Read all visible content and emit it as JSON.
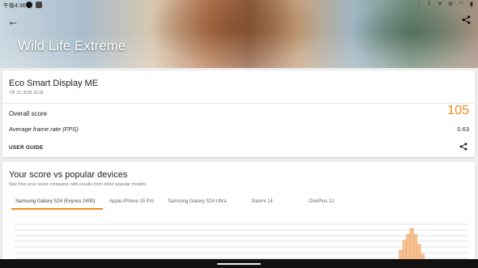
{
  "status_bar": {
    "time": "午後4:36",
    "icons": [
      "notification-dot-icon",
      "app-icon",
      "vibrate-icon",
      "bluetooth-icon",
      "mute-icon",
      "dnd-icon",
      "wifi-icon",
      "battery-icon"
    ]
  },
  "header": {
    "title": "Wild Life Extreme",
    "back_icon": "arrow-left-icon",
    "share_icon": "share-icon"
  },
  "result": {
    "device_name": "Eco Smart Display ME",
    "date": "7月 23, 2025 16:35",
    "overall_score_label": "Overall score",
    "overall_score_value": "105",
    "fps_label": "Average frame rate (FPS)",
    "fps_value": "0.63",
    "user_guide_label": "USER GUIDE",
    "accent_color": "#f28a1d"
  },
  "comparison": {
    "heading": "Your score vs popular devices",
    "subtitle": "See how your score compares with results from other popular models.",
    "tabs": [
      {
        "label": "Samsung Galaxy S24 (Exynos 2400)",
        "active": true
      },
      {
        "label": "Apple iPhone 15 Pro",
        "active": false
      },
      {
        "label": "Samsung Galaxy S24 Ultra",
        "active": false
      },
      {
        "label": "Xiaomi 14",
        "active": false
      },
      {
        "label": "OnePlus 12",
        "active": false
      }
    ]
  },
  "chart_data": {
    "type": "bar",
    "gridlines": 7,
    "bar_color": "#f6c08f",
    "histogram_left": [
      0.1
    ],
    "histogram_main": [
      0.2,
      0.45,
      0.7,
      0.85,
      1.0,
      0.85,
      0.6,
      0.35,
      0.15
    ]
  }
}
